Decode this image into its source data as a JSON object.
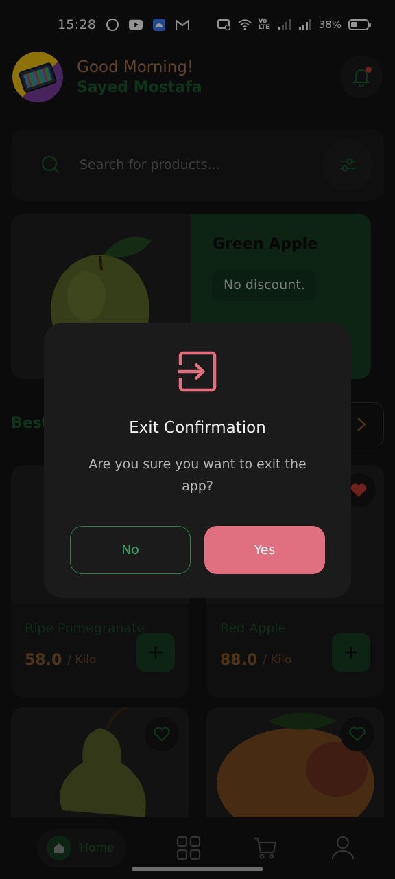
{
  "status_bar": {
    "time": "15:28",
    "battery": "38%",
    "network_label": "Vo LTE"
  },
  "header": {
    "greeting": "Good Morning!",
    "user_name": "Sayed Mostafa"
  },
  "search": {
    "placeholder": "Search for products..."
  },
  "promo": {
    "title": "Green Apple",
    "badge": "No discount."
  },
  "section": {
    "title": "Best"
  },
  "products": [
    {
      "name": "Ripe Pomegranate",
      "price": "58.0",
      "unit": "/ Kilo",
      "favorite": false
    },
    {
      "name": "Red Apple",
      "price": "88.0",
      "unit": "/ Kilo",
      "favorite": true
    },
    {
      "name": "",
      "price": "",
      "unit": "",
      "favorite": false
    },
    {
      "name": "",
      "price": "",
      "unit": "",
      "favorite": false
    }
  ],
  "nav": {
    "home_label": "Home"
  },
  "dialog": {
    "title": "Exit Confirmation",
    "message": "Are you sure you want to exit the app?",
    "no_label": "No",
    "yes_label": "Yes"
  },
  "colors": {
    "accent_green": "#1d5a30",
    "confirm_pink": "#e0707f",
    "price_brown": "#8a5a2c"
  }
}
